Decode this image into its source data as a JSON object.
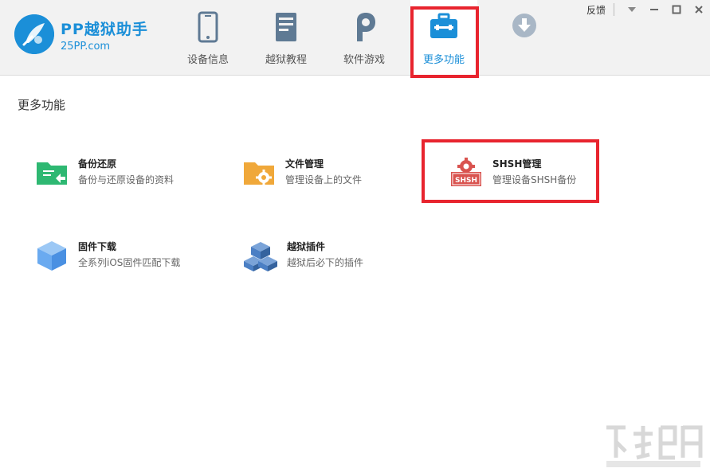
{
  "app": {
    "name": "PP越狱助手",
    "url": "25PP.com"
  },
  "tabs": [
    {
      "label": "设备信息",
      "icon": "phone-icon"
    },
    {
      "label": "越狱教程",
      "icon": "book-icon"
    },
    {
      "label": "软件游戏",
      "icon": "pp-icon"
    },
    {
      "label": "更多功能",
      "icon": "toolbox-icon",
      "active": true
    },
    {
      "label": "",
      "icon": "download-icon"
    }
  ],
  "topbar": {
    "feedback": "反馈",
    "menu_icon": "chevron-down-icon",
    "minimize_icon": "minimize-icon",
    "maximize_icon": "maximize-icon",
    "close_icon": "close-icon"
  },
  "section": {
    "title": "更多功能"
  },
  "features": [
    {
      "title": "备份还原",
      "desc": "备份与还原设备的资料",
      "icon": "backup-folder-icon",
      "color": "#2eb872"
    },
    {
      "title": "文件管理",
      "desc": "管理设备上的文件",
      "icon": "file-folder-icon",
      "color": "#f0a83a"
    },
    {
      "title": "SHSH管理",
      "desc": "管理设备SHSH备份",
      "icon": "shsh-icon",
      "color": "#d9534f",
      "badge": "SHSH"
    },
    {
      "title": "固件下载",
      "desc": "全系列iOS固件匹配下载",
      "icon": "firmware-cube-icon",
      "color": "#6aaaf0"
    },
    {
      "title": "越狱插件",
      "desc": "越狱后必下的插件",
      "icon": "plugin-boxes-icon",
      "color": "#4b7fc4"
    }
  ],
  "colors": {
    "accent": "#1b8fd8",
    "highlight": "#e8242e"
  }
}
